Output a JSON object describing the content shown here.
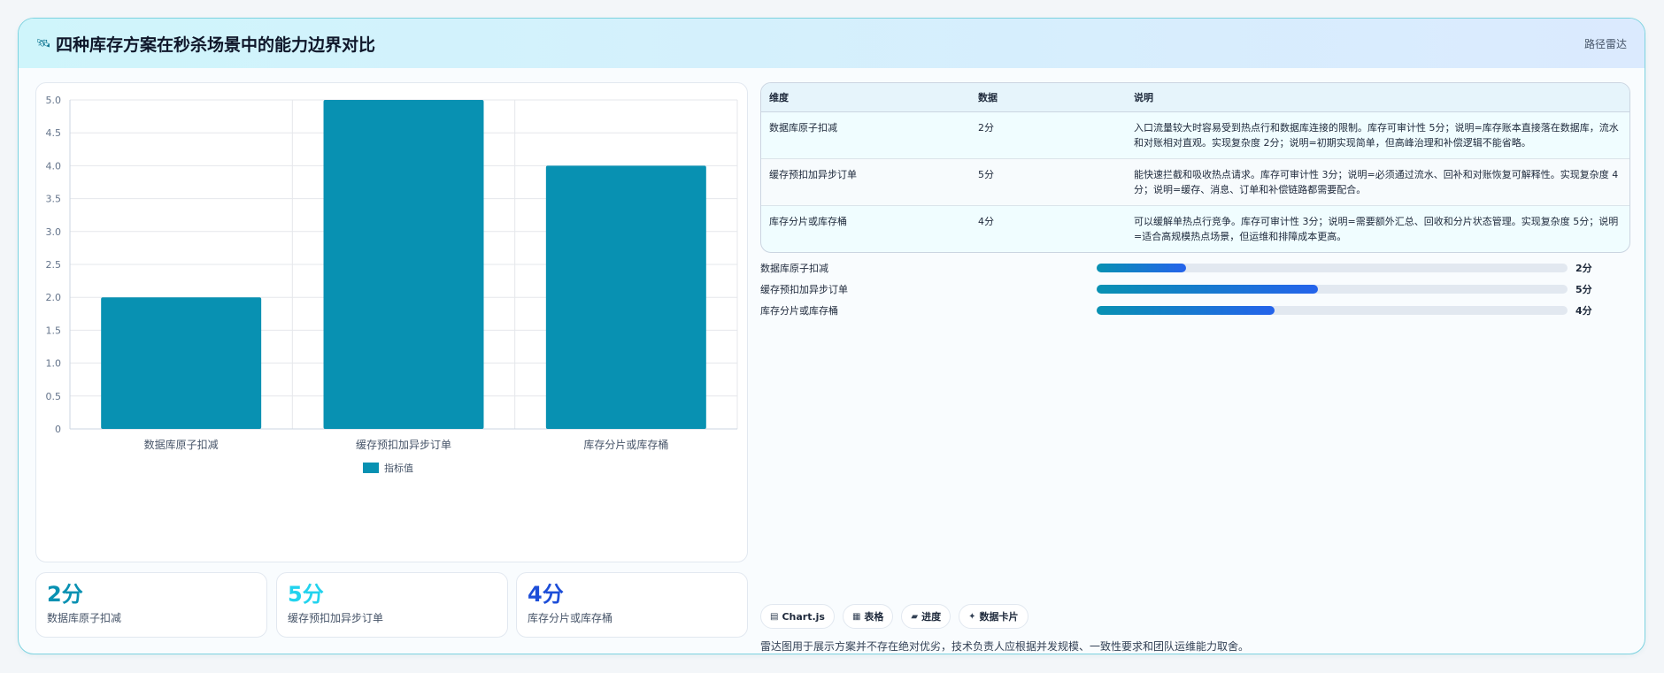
{
  "header": {
    "icon": "satellite-icon",
    "icon_glyph": "🛰",
    "title": "四种库存方案在秒杀场景中的能力边界对比",
    "tag": "路径雷达"
  },
  "colors": {
    "bar": "#0891b2",
    "stat_teal": "#0891b2",
    "stat_cyan": "#22d3ee",
    "stat_blue": "#1d4ed8"
  },
  "chart_data": {
    "type": "bar",
    "categories": [
      "数据库原子扣减",
      "缓存预扣加异步订单",
      "库存分片或库存桶"
    ],
    "series": [
      {
        "name": "指标值",
        "values": [
          2,
          5,
          4
        ]
      }
    ],
    "ylim": [
      0,
      5
    ],
    "yticks": [
      "0",
      "0.5",
      "1.0",
      "1.5",
      "2.0",
      "2.5",
      "3.0",
      "3.5",
      "4.0",
      "4.5",
      "5.0"
    ],
    "grid": true,
    "legend": "bottom"
  },
  "stats": [
    {
      "value": "2分",
      "label": "数据库原子扣减"
    },
    {
      "value": "5分",
      "label": "缓存预扣加异步订单"
    },
    {
      "value": "4分",
      "label": "库存分片或库存桶"
    }
  ],
  "table": {
    "headers": [
      "维度",
      "数据",
      "说明"
    ],
    "rows": [
      {
        "dim": "数据库原子扣减",
        "val": "2分",
        "desc": "入口流量较大时容易受到热点行和数据库连接的限制。库存可审计性 5分；说明=库存账本直接落在数据库，流水和对账相对直观。实现复杂度 2分；说明=初期实现简单，但高峰治理和补偿逻辑不能省略。"
      },
      {
        "dim": "缓存预扣加异步订单",
        "val": "5分",
        "desc": "能快速拦截和吸收热点请求。库存可审计性 3分；说明=必须通过流水、回补和对账恢复可解释性。实现复杂度 4分；说明=缓存、消息、订单和补偿链路都需要配合。"
      },
      {
        "dim": "库存分片或库存桶",
        "val": "4分",
        "desc": "可以缓解单热点行竞争。库存可审计性 3分；说明=需要额外汇总、回收和分片状态管理。实现复杂度 5分；说明=适合高规模热点场景，但运维和排障成本更高。"
      }
    ]
  },
  "progress": [
    {
      "label": "数据库原子扣减",
      "value": "2分",
      "fraction": 0.19
    },
    {
      "label": "缓存预扣加异步订单",
      "value": "5分",
      "fraction": 0.47
    },
    {
      "label": "库存分片或库存桶",
      "value": "4分",
      "fraction": 0.377
    }
  ],
  "chips": [
    {
      "icon": "chart-icon",
      "glyph": "▤",
      "label": "Chart.js"
    },
    {
      "icon": "table-icon",
      "glyph": "▦",
      "label": "表格"
    },
    {
      "icon": "progress-icon",
      "glyph": "▰",
      "label": "进度"
    },
    {
      "icon": "sparkle-icon",
      "glyph": "✦",
      "label": "数据卡片"
    }
  ],
  "footnote": "雷达图用于展示方案并不存在绝对优劣，技术负责人应根据并发规模、一致性要求和团队运维能力取舍。"
}
